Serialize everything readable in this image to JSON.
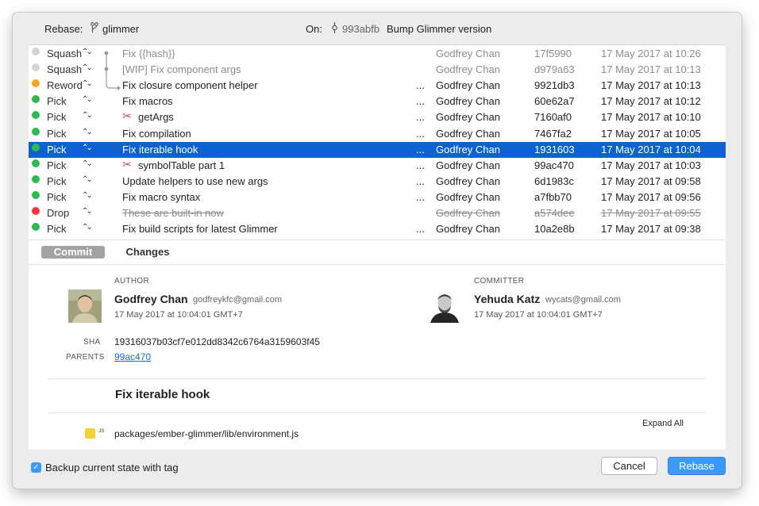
{
  "header": {
    "rebase_label": "Rebase:",
    "branch_icon": "branch-icon",
    "branch": "glimmer",
    "on_label": "On:",
    "commit_icon": "commit-icon",
    "on_hash": "993abfb",
    "on_message": "Bump Glimmer version"
  },
  "colors": {
    "pick": "#2db94d",
    "squash": "#d4d4d4",
    "reword": "#f5a623",
    "drop": "#f03a3a",
    "selection": "#0a63d1",
    "primary_button": "#3b99fc"
  },
  "commits": [
    {
      "action": "Squash",
      "status": "squash",
      "message": "Fix {{hash}}",
      "dots": "",
      "author": "Godfrey Chan",
      "hash": "17f5990",
      "date": "17 May 2017 at 10:26"
    },
    {
      "action": "Squash",
      "status": "squash",
      "message": "[WIP] Fix component args",
      "dots": "",
      "author": "Godfrey Chan",
      "hash": "d979a63",
      "date": "17 May 2017 at 10:13"
    },
    {
      "action": "Reword",
      "status": "reword",
      "message": "Fix closure component helper",
      "dots": "...",
      "author": "Godfrey Chan",
      "hash": "9921db3",
      "date": "17 May 2017 at 10:13"
    },
    {
      "action": "Pick",
      "status": "pick",
      "message": "Fix macros",
      "dots": "...",
      "author": "Godfrey Chan",
      "hash": "60e62a7",
      "date": "17 May 2017 at 10:12"
    },
    {
      "action": "Pick",
      "status": "pick",
      "message": "getArgs",
      "dots": "...",
      "author": "Godfrey Chan",
      "hash": "7160af0",
      "date": "17 May 2017 at 10:10"
    },
    {
      "action": "Pick",
      "status": "pick",
      "message": "Fix compilation",
      "dots": "...",
      "author": "Godfrey Chan",
      "hash": "7467fa2",
      "date": "17 May 2017 at 10:05"
    },
    {
      "action": "Pick",
      "status": "pick",
      "message": "Fix iterable hook",
      "dots": "...",
      "author": "Godfrey Chan",
      "hash": "1931603",
      "date": "17 May 2017 at 10:04"
    },
    {
      "action": "Pick",
      "status": "pick",
      "message": "symbolTable part 1",
      "dots": "...",
      "author": "Godfrey Chan",
      "hash": "99ac470",
      "date": "17 May 2017 at 10:03"
    },
    {
      "action": "Pick",
      "status": "pick",
      "message": "Update helpers to use new args",
      "dots": "...",
      "author": "Godfrey Chan",
      "hash": "6d1983c",
      "date": "17 May 2017 at 09:58"
    },
    {
      "action": "Pick",
      "status": "pick",
      "message": "Fix macro syntax",
      "dots": "...",
      "author": "Godfrey Chan",
      "hash": "a7fbb70",
      "date": "17 May 2017 at 09:56"
    },
    {
      "action": "Drop",
      "status": "drop",
      "message": "These are built-in now",
      "dots": "",
      "author": "Godfrey Chan",
      "hash": "a574dee",
      "date": "17 May 2017 at 09:55"
    },
    {
      "action": "Pick",
      "status": "pick",
      "message": "Fix build scripts for latest Glimmer",
      "dots": "...",
      "author": "Godfrey Chan",
      "hash": "10a2e8b",
      "date": "17 May 2017 at 09:38"
    }
  ],
  "split_icon": "scissors-icon",
  "tabs": [
    "Commit",
    "Changes"
  ],
  "detail": {
    "author_label": "AUTHOR",
    "author_name": "Godfrey Chan",
    "author_email": "godfreykfc@gmail.com",
    "author_date": "17 May 2017 at 10:04:01 GMT+7",
    "committer_label": "COMMITTER",
    "committer_name": "Yehuda Katz",
    "committer_email": "wycats@gmail.com",
    "committer_date": "17 May 2017 at 10:04:01 GMT+7",
    "sha_label": "SHA",
    "sha": "19316037b03cf7e012dd8342c6764a3159603f45",
    "parents_label": "PARENTS",
    "parent": "99ac470",
    "message": "Fix iterable hook",
    "expand_all": "Expand All",
    "file_icon_text": "JS",
    "file": "packages/ember-glimmer/lib/environment.js"
  },
  "footer": {
    "backup_label": "Backup current state with tag",
    "cancel": "Cancel",
    "rebase": "Rebase"
  }
}
